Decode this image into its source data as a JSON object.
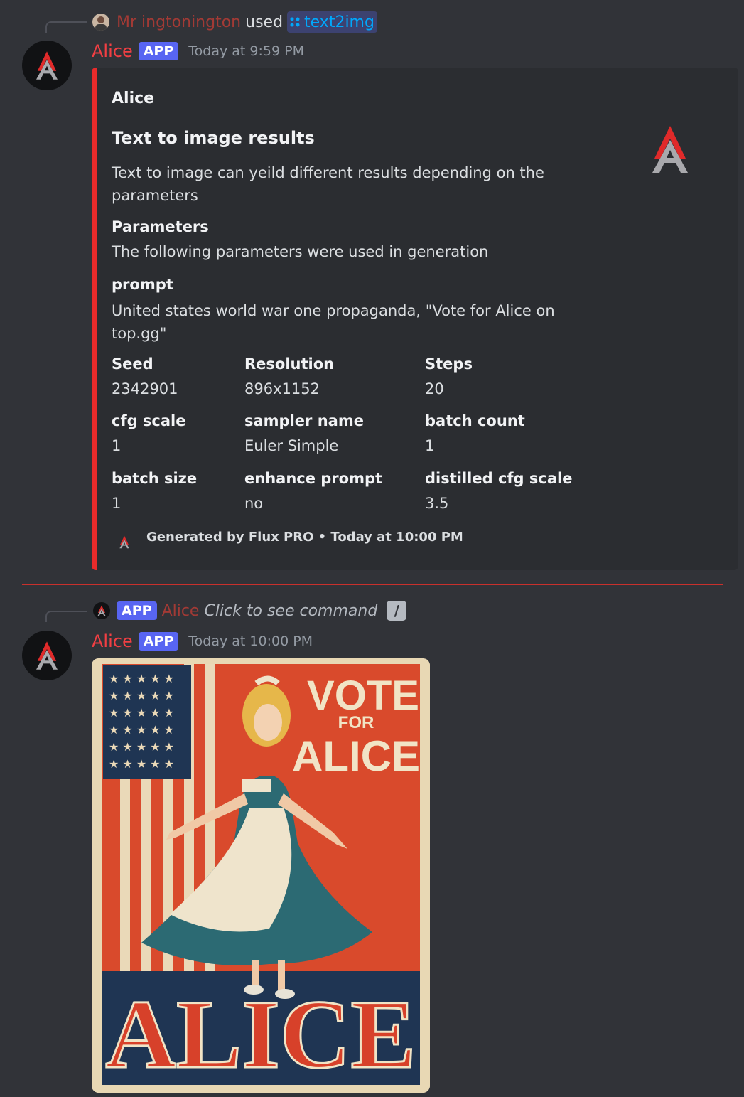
{
  "message1": {
    "reply": {
      "user": "Mr ingtonington",
      "verb": "used",
      "command": "text2img"
    },
    "author": "Alice",
    "badge": "APP",
    "timestamp": "Today at 9:59 PM",
    "embed": {
      "author": "Alice",
      "title": "Text to image results",
      "description": "Text to image can yeild different results depending on the parameters",
      "parameters_heading": "Parameters",
      "parameters_text": "The following parameters were used in generation",
      "prompt_heading": "prompt",
      "prompt_text": "United states world war one propaganda, \"Vote for Alice on top.gg\"",
      "fields": [
        {
          "name": "Seed",
          "value": "2342901"
        },
        {
          "name": "Resolution",
          "value": "896x1152"
        },
        {
          "name": "Steps",
          "value": "20"
        },
        {
          "name": "cfg scale",
          "value": "1"
        },
        {
          "name": "sampler name",
          "value": "Euler Simple"
        },
        {
          "name": "batch count",
          "value": "1"
        },
        {
          "name": "batch size",
          "value": "1"
        },
        {
          "name": "enhance prompt",
          "value": "no"
        },
        {
          "name": "distilled cfg scale",
          "value": "3.5"
        }
      ],
      "footer": "Generated by Flux PRO • Today at 10:00 PM",
      "accent_color": "#e92b2b"
    }
  },
  "message2": {
    "reply": {
      "badge": "APP",
      "user": "Alice",
      "command_hint": "Click to see command"
    },
    "author": "Alice",
    "badge": "APP",
    "timestamp": "Today at 10:00 PM",
    "image": {
      "headline_top": "VOTE",
      "headline_mid": "FOR",
      "headline_bottom": "ALICE",
      "big_name": "ALICE"
    }
  },
  "colors": {
    "background": "#313338",
    "embed_bg": "#2b2d31",
    "author_red": "#f23f43",
    "app_badge": "#5865f2",
    "link_blue": "#00a8fc"
  }
}
